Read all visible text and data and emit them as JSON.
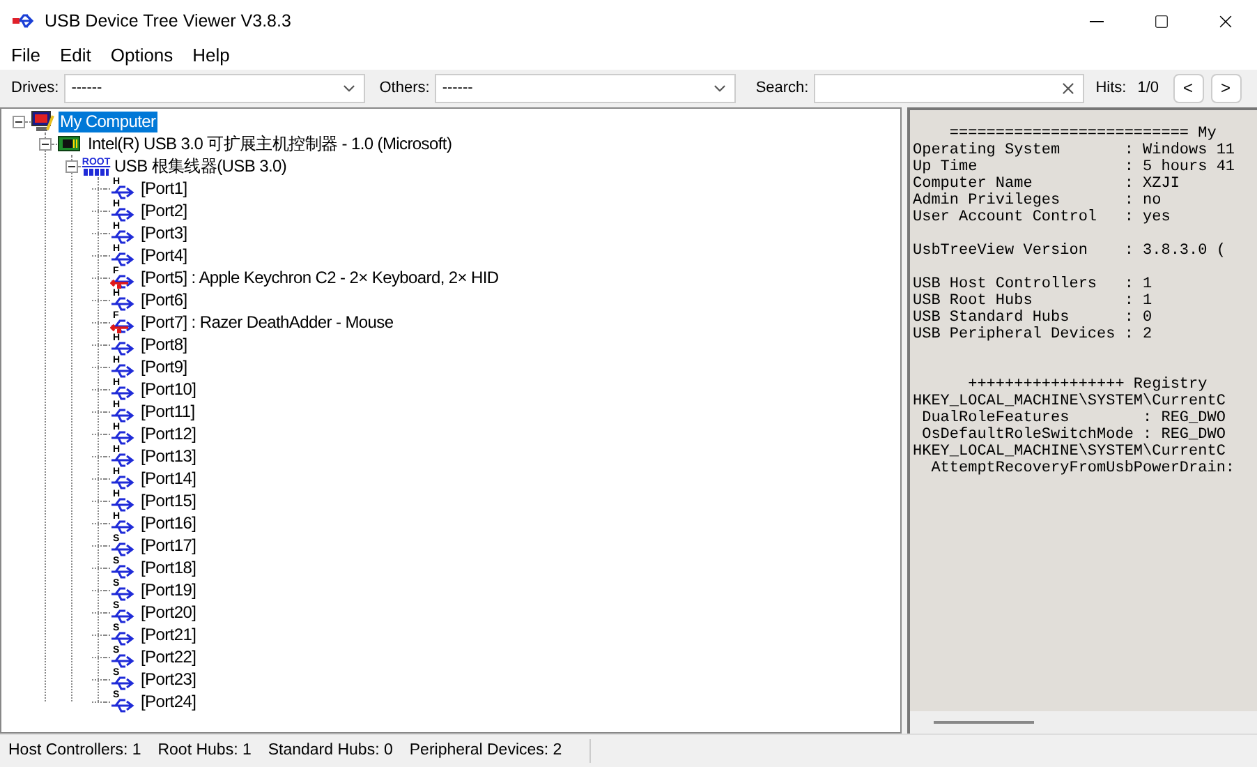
{
  "window": {
    "title": "USB Device Tree Viewer V3.8.3"
  },
  "menu": [
    "File",
    "Edit",
    "Options",
    "Help"
  ],
  "toolbar": {
    "drives": {
      "label": "Drives:",
      "value": "------"
    },
    "others": {
      "label": "Others:",
      "value": "------"
    },
    "search": {
      "label": "Search:"
    },
    "hits": {
      "label": "Hits:",
      "value": "1/0"
    },
    "prev": "<",
    "next": ">"
  },
  "tree": [
    {
      "kind": "computer",
      "label": "My Computer",
      "selected": true,
      "expanded": true,
      "children": [
        {
          "kind": "controller",
          "label": "Intel(R) USB 3.0 可扩展主机控制器 - 1.0 (Microsoft)",
          "selected": false,
          "expanded": true,
          "children": [
            {
              "kind": "root_hub",
              "badge": "ROOT",
              "label": "USB 根集线器(USB 3.0)",
              "selected": false,
              "expanded": true,
              "children": [
                {
                  "kind": "port",
                  "badge": "H",
                  "connected": false,
                  "label": "[Port1]",
                  "selected": false
                },
                {
                  "kind": "port",
                  "badge": "H",
                  "connected": false,
                  "label": "[Port2]",
                  "selected": false
                },
                {
                  "kind": "port",
                  "badge": "H",
                  "connected": false,
                  "label": "[Port3]",
                  "selected": false
                },
                {
                  "kind": "port",
                  "badge": "H",
                  "connected": false,
                  "label": "[Port4]",
                  "selected": false
                },
                {
                  "kind": "port",
                  "badge": "F",
                  "connected": true,
                  "label": "[Port5] : Apple Keychron C2 - 2× Keyboard, 2× HID",
                  "selected": false
                },
                {
                  "kind": "port",
                  "badge": "H",
                  "connected": false,
                  "label": "[Port6]",
                  "selected": false
                },
                {
                  "kind": "port",
                  "badge": "F",
                  "connected": true,
                  "label": "[Port7] : Razer DeathAdder - Mouse",
                  "selected": false
                },
                {
                  "kind": "port",
                  "badge": "H",
                  "connected": false,
                  "label": "[Port8]",
                  "selected": false
                },
                {
                  "kind": "port",
                  "badge": "H",
                  "connected": false,
                  "label": "[Port9]",
                  "selected": false
                },
                {
                  "kind": "port",
                  "badge": "H",
                  "connected": false,
                  "label": "[Port10]",
                  "selected": false
                },
                {
                  "kind": "port",
                  "badge": "H",
                  "connected": false,
                  "label": "[Port11]",
                  "selected": false
                },
                {
                  "kind": "port",
                  "badge": "H",
                  "connected": false,
                  "label": "[Port12]",
                  "selected": false
                },
                {
                  "kind": "port",
                  "badge": "H",
                  "connected": false,
                  "label": "[Port13]",
                  "selected": false
                },
                {
                  "kind": "port",
                  "badge": "H",
                  "connected": false,
                  "label": "[Port14]",
                  "selected": false
                },
                {
                  "kind": "port",
                  "badge": "H",
                  "connected": false,
                  "label": "[Port15]",
                  "selected": false
                },
                {
                  "kind": "port",
                  "badge": "H",
                  "connected": false,
                  "label": "[Port16]",
                  "selected": false
                },
                {
                  "kind": "port",
                  "badge": "S",
                  "connected": false,
                  "label": "[Port17]",
                  "selected": false
                },
                {
                  "kind": "port",
                  "badge": "S",
                  "connected": false,
                  "label": "[Port18]",
                  "selected": false
                },
                {
                  "kind": "port",
                  "badge": "S",
                  "connected": false,
                  "label": "[Port19]",
                  "selected": false
                },
                {
                  "kind": "port",
                  "badge": "S",
                  "connected": false,
                  "label": "[Port20]",
                  "selected": false
                },
                {
                  "kind": "port",
                  "badge": "S",
                  "connected": false,
                  "label": "[Port21]",
                  "selected": false
                },
                {
                  "kind": "port",
                  "badge": "S",
                  "connected": false,
                  "label": "[Port22]",
                  "selected": false
                },
                {
                  "kind": "port",
                  "badge": "S",
                  "connected": false,
                  "label": "[Port23]",
                  "selected": false
                },
                {
                  "kind": "port",
                  "badge": "S",
                  "connected": false,
                  "label": "[Port24]",
                  "selected": false
                }
              ]
            }
          ]
        }
      ]
    }
  ],
  "info_panel": {
    "sections": [
      {
        "kind": "summary",
        "lines": [
          "    ========================== My",
          "Operating System       : Windows 11",
          "Up Time                : 5 hours 41",
          "Computer Name          : XZJI",
          "Admin Privileges       : no",
          "User Account Control   : yes"
        ]
      },
      {
        "kind": "summary",
        "lines": [
          "UsbTreeView Version    : 3.8.3.0 ("
        ]
      },
      {
        "kind": "summary",
        "lines": [
          "USB Host Controllers   : 1",
          "USB Root Hubs          : 1",
          "USB Standard Hubs      : 0",
          "USB Peripheral Devices : 2"
        ]
      },
      {
        "kind": "registry",
        "lines": [
          "      +++++++++++++++++ Registry",
          "HKEY_LOCAL_MACHINE\\SYSTEM\\CurrentC",
          " DualRoleFeatures        : REG_DWO",
          " OsDefaultRoleSwitchMode : REG_DWO",
          "HKEY_LOCAL_MACHINE\\SYSTEM\\CurrentC",
          "  AttemptRecoveryFromUsbPowerDrain:"
        ]
      }
    ]
  },
  "status_bar": [
    "Host Controllers: 1",
    "Root Hubs: 1",
    "Standard Hubs: 0",
    "Peripheral Devices: 2"
  ]
}
